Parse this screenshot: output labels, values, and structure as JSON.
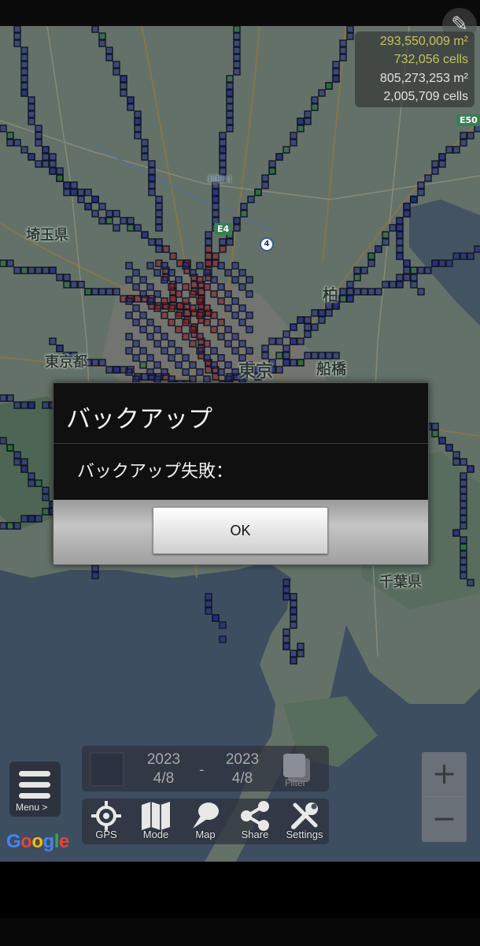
{
  "stats": {
    "area_current": "293,550,009 m²",
    "cells_current": "732,056 cells",
    "area_total": "805,273,253 m²",
    "cells_total": "2,005,709 cells"
  },
  "map": {
    "labels": {
      "saitama": "埼玉県",
      "tokyo_to": "東京都",
      "tokyo": "東京",
      "kashiwa": "柏",
      "funabashi": "船橋",
      "chiba": "千葉",
      "chiba_ken": "千葉県",
      "tonegawa": "利根川"
    },
    "shields": {
      "e4": "E4",
      "e50": "E50",
      "route4": "4"
    }
  },
  "dialog": {
    "title": "バックアップ",
    "message": "バックアップ失敗：",
    "ok_label": "OK"
  },
  "date_range": {
    "start_year": "2023",
    "start_day": "4/8",
    "separator": "-",
    "end_year": "2023",
    "end_day": "4/8",
    "filter_label": "Filter"
  },
  "menu": {
    "label": "Menu >"
  },
  "toolbar": {
    "gps": "GPS",
    "mode": "Mode",
    "map": "Map",
    "share": "Share",
    "settings": "Settings"
  },
  "zoom": {
    "in": "+",
    "out": "−"
  },
  "attribution": "Google",
  "colors": {
    "accent_stats": "#c9c256",
    "land": "#8fa395",
    "sea": "#5a708c",
    "cell_outline": "#1a1f3a",
    "cell_blue": "#2a3bb0",
    "cell_red": "#c02a2a",
    "cell_green": "#2a9a45"
  }
}
